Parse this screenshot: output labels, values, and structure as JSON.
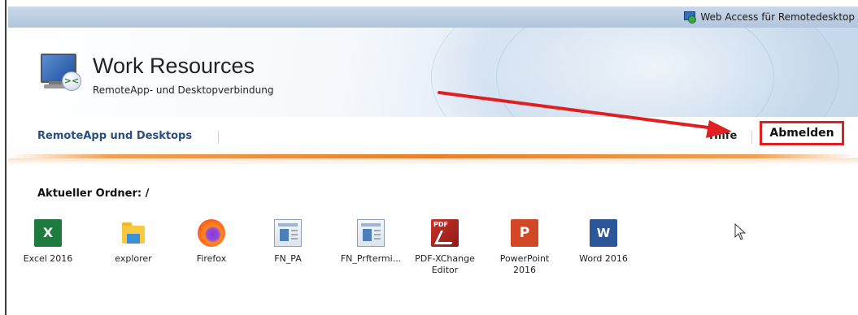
{
  "topbar": {
    "title": "Web Access für Remotedesktop",
    "icon": "remote-desktop-icon"
  },
  "header": {
    "title": "Work Resources",
    "subtitle": "RemoteApp- und Desktopverbindung",
    "logo_icon": "remote-computer-logo-icon"
  },
  "nav": {
    "remoteapp_label": "RemoteApp und Desktops",
    "help_label": "Hilfe",
    "logout_label": "Abmelden"
  },
  "content": {
    "folder_label": "Aktueller Ordner: /",
    "apps": [
      {
        "label": "Excel 2016",
        "icon": "excel-icon",
        "glyph": "X"
      },
      {
        "label": "explorer",
        "icon": "folder-explorer-icon"
      },
      {
        "label": "Firefox",
        "icon": "firefox-icon"
      },
      {
        "label": "FN_PA",
        "icon": "remoteapp-window-icon"
      },
      {
        "label": "FN_Prftermi...",
        "icon": "remoteapp-window-icon"
      },
      {
        "label": "PDF-XChange\nEditor",
        "icon": "pdf-xchange-icon",
        "glyph": "PDF"
      },
      {
        "label": "PowerPoint\n2016",
        "icon": "powerpoint-icon",
        "glyph": "P"
      },
      {
        "label": "Word 2016",
        "icon": "word-icon",
        "glyph": "W"
      }
    ]
  },
  "colors": {
    "accent_orange": "#e8802a",
    "annotation_red": "#e02020",
    "nav_blue": "#2b4f7e"
  }
}
